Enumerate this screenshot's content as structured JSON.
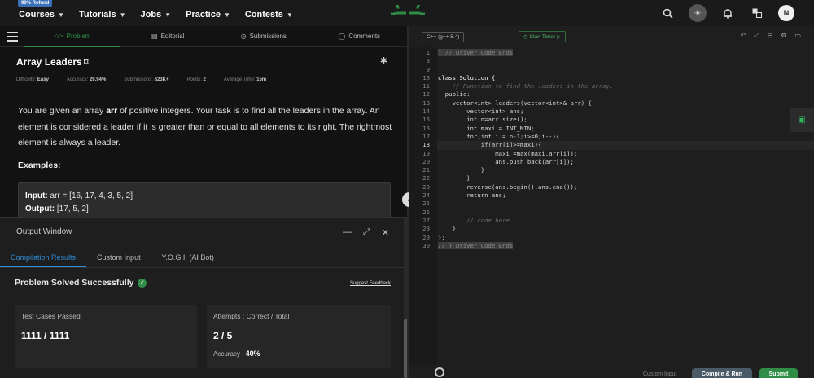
{
  "nav": {
    "badge": "90% Refund",
    "items": [
      "Courses",
      "Tutorials",
      "Jobs",
      "Practice",
      "Contests"
    ],
    "avatar_initial": "N"
  },
  "tabs": [
    {
      "label": "Problem",
      "icon": "code-icon"
    },
    {
      "label": "Editorial",
      "icon": "document-icon"
    },
    {
      "label": "Submissions",
      "icon": "clock-icon"
    },
    {
      "label": "Comments",
      "icon": "chat-icon"
    }
  ],
  "problem": {
    "title": "Array Leaders",
    "meta": [
      {
        "label": "Difficulty:",
        "value": "Easy"
      },
      {
        "label": "Accuracy:",
        "value": "29.94%"
      },
      {
        "label": "Submissions:",
        "value": "823K+"
      },
      {
        "label": "Points:",
        "value": "2"
      },
      {
        "label": "Average Time:",
        "value": "15m"
      }
    ],
    "desc_1": "You are given an array ",
    "desc_arr": "arr",
    "desc_2": " of positive integers. Your task is to find all the leaders in the array. An element is considered a leader if it is greater than or equal to all elements to its right. The rightmost element is always a leader.",
    "examples_heading": "Examples:",
    "input_label": "Input:",
    "input_value": "arr = [16, 17, 4, 3, 5, 2]",
    "output_label": "Output:",
    "output_value": "[17, 5, 2]"
  },
  "output_window": {
    "title": "Output Window",
    "tabs": [
      "Compilation Results",
      "Custom Input",
      "Y.O.G.I. (AI Bot)"
    ],
    "status": "Problem Solved Successfully",
    "suggest": "Suggest Feedback",
    "cases_label": "Test Cases Passed",
    "cases_value": "1111 / 1111",
    "attempts_label": "Attempts : Correct / Total",
    "attempts_value": "2 / 5",
    "accuracy_label": "Accuracy : ",
    "accuracy_value": "40%"
  },
  "editor": {
    "language": "C++ (g++ 5.4)",
    "timer": "Start Timer",
    "lines": [
      "} // Driver Code Ends",
      "",
      "",
      "class Solution {",
      "    // Function to find the leaders in the array.",
      "  public:",
      "    vector<int> leaders(vector<int>& arr) {",
      "        vector<int> ans;",
      "        int n=arr.size();",
      "        int maxi = INT_MIN;",
      "        for(int i = n-1;i>=0;i--){",
      "            if(arr[i]>=maxi){",
      "                maxi =max(maxi,arr[i]);",
      "                ans.push_back(arr[i]);",
      "            }",
      "        }",
      "        reverse(ans.begin(),ans.end());",
      "        return ans;",
      "",
      "",
      "        // code here",
      "    }",
      "};",
      "// } Driver Code Ends"
    ],
    "custom_input": "Custom Input",
    "compile": "Compile & Run",
    "submit": "Submit"
  }
}
